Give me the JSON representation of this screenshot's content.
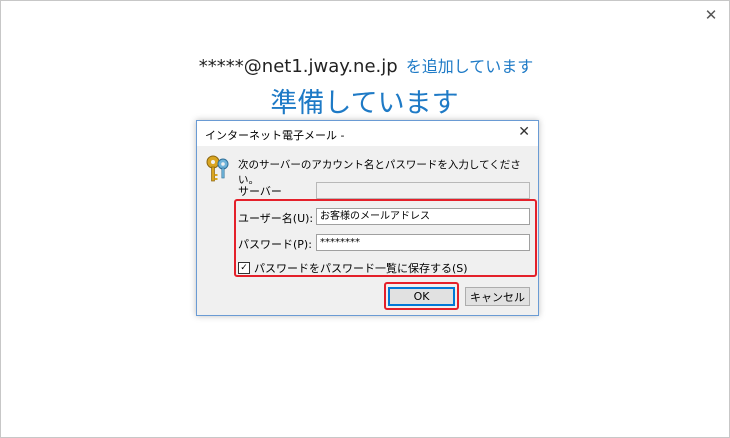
{
  "window": {
    "close_glyph": "✕",
    "account_email": "*****@net1.jway.ne.jp",
    "account_suffix": "を追加しています",
    "status": "準備しています"
  },
  "dialog": {
    "title": "インターネット電子メール -",
    "close_glyph": "✕",
    "message": "次のサーバーのアカウント名とパスワードを入力してください。",
    "server_label": "サーバー",
    "server_value": "",
    "username_label": "ユーザー名(U):",
    "username_value": "お客様のメールアドレス",
    "password_label": "パスワード(P):",
    "password_value": "********",
    "save_password_label": "パスワードをパスワード一覧に保存する(S)",
    "save_password_checked": true,
    "check_glyph": "✓",
    "ok_label": "OK",
    "cancel_label": "キャンセル"
  },
  "colors": {
    "accent": "#1e7ac6",
    "highlight": "#e4202a",
    "dialog_border": "#6a9bd4"
  },
  "icons": [
    "keys-icon",
    "close-icon",
    "checkbox-check-icon"
  ]
}
